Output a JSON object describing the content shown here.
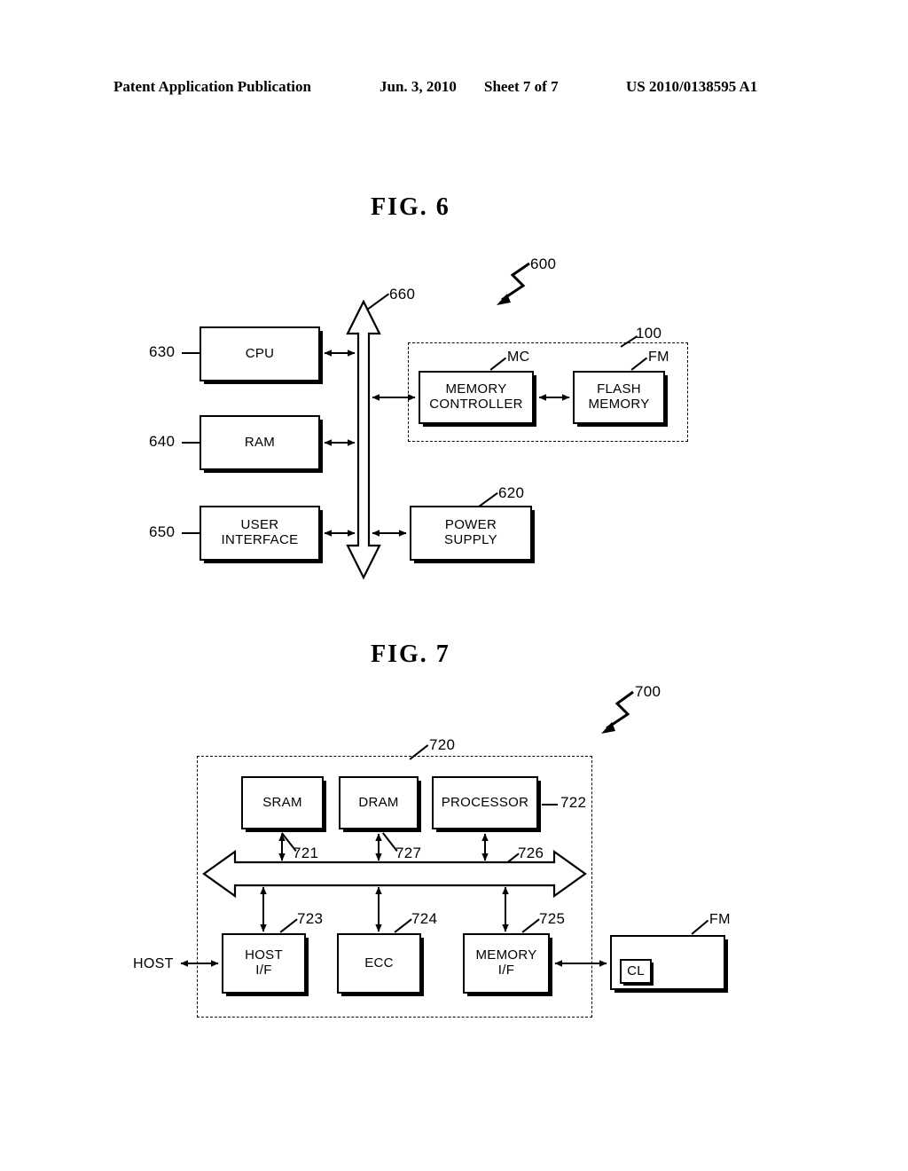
{
  "header": {
    "publication": "Patent Application Publication",
    "date": "Jun. 3, 2010",
    "sheet": "Sheet 7 of 7",
    "number": "US 2010/0138595 A1"
  },
  "figures": [
    {
      "title": "FIG.  6",
      "system_ref": "600",
      "bus_ref": "660",
      "enclosure_ref": "100",
      "blocks": [
        {
          "id": "cpu",
          "label": "CPU",
          "ref": "630"
        },
        {
          "id": "ram",
          "label": "RAM",
          "ref": "640"
        },
        {
          "id": "user-interface",
          "label": "USER\nINTERFACE",
          "ref": "650"
        },
        {
          "id": "memory-controller",
          "label": "MEMORY\nCONTROLLER",
          "ref": "MC"
        },
        {
          "id": "flash-memory",
          "label": "FLASH\nMEMORY",
          "ref": "FM"
        },
        {
          "id": "power-supply",
          "label": "POWER\nSUPPLY",
          "ref": "620"
        }
      ]
    },
    {
      "title": "FIG.  7",
      "system_ref": "700",
      "bus_ref": "726",
      "enclosure_ref": "720",
      "external_label": "HOST",
      "blocks": [
        {
          "id": "sram",
          "label": "SRAM",
          "ref": "721"
        },
        {
          "id": "dram",
          "label": "DRAM",
          "ref": "727"
        },
        {
          "id": "processor",
          "label": "PROCESSOR",
          "ref": "722"
        },
        {
          "id": "host-if",
          "label": "HOST\nI/F",
          "ref": "723"
        },
        {
          "id": "ecc",
          "label": "ECC",
          "ref": "724"
        },
        {
          "id": "memory-if",
          "label": "MEMORY\nI/F",
          "ref": "725"
        },
        {
          "id": "flash-memory",
          "label": "",
          "ref": "FM"
        },
        {
          "id": "cl",
          "label": "CL",
          "ref": ""
        }
      ]
    }
  ],
  "colors": {
    "ink": "#000000",
    "paper": "#ffffff"
  }
}
